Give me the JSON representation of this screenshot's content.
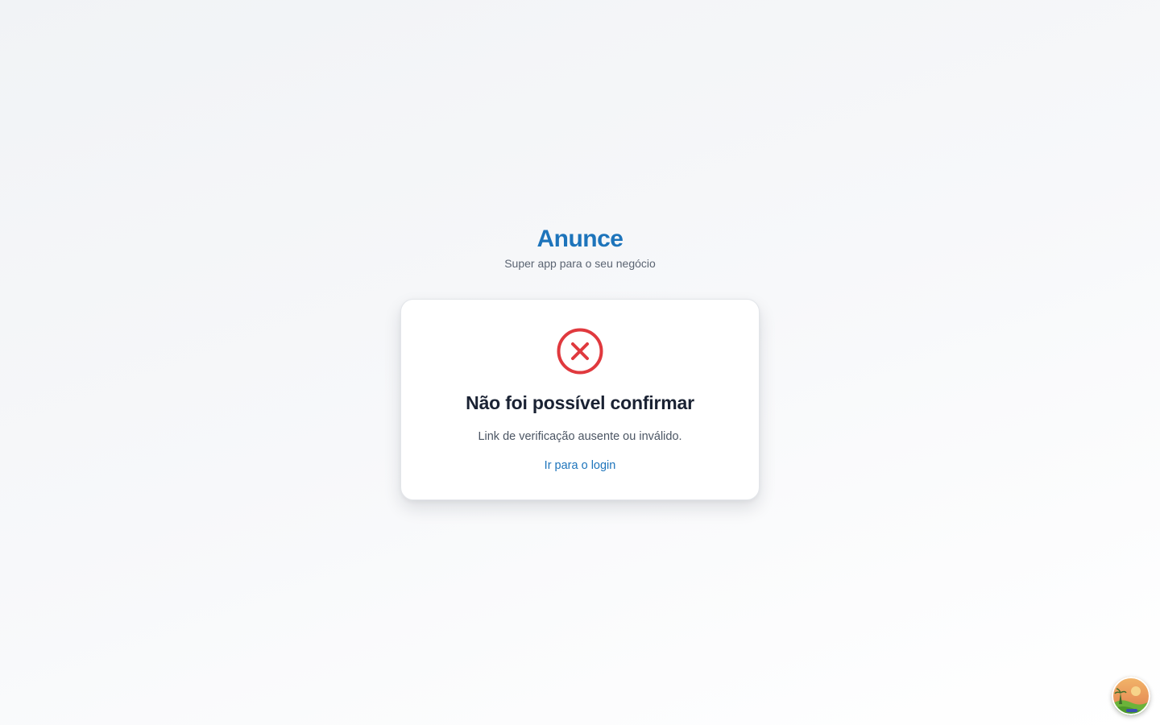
{
  "brand": {
    "title": "Anunce",
    "subtitle": "Super app para o seu negócio"
  },
  "card": {
    "icon": "error-x-circle-icon",
    "title": "Não foi possível confirmar",
    "message": "Link de verificação ausente ou inválido.",
    "login_link": "Ir para o login"
  },
  "colors": {
    "brand": "#1d74bb",
    "error": "#e0393e",
    "title_text": "#1a2233",
    "muted_text": "#5b6472"
  },
  "floating_avatar": {
    "icon": "profile-avatar-icon"
  }
}
